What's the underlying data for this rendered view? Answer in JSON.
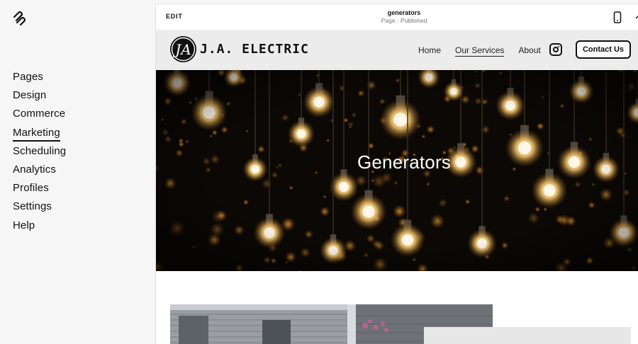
{
  "sidebar": {
    "logo_icon": "squarespace-logo-icon",
    "items": [
      {
        "label": "Pages",
        "active": false
      },
      {
        "label": "Design",
        "active": false
      },
      {
        "label": "Commerce",
        "active": false
      },
      {
        "label": "Marketing",
        "active": true
      },
      {
        "label": "Scheduling",
        "active": false
      },
      {
        "label": "Analytics",
        "active": false
      },
      {
        "label": "Profiles",
        "active": false
      },
      {
        "label": "Settings",
        "active": false
      },
      {
        "label": "Help",
        "active": false
      }
    ]
  },
  "editor_bar": {
    "edit_label": "EDIT",
    "page_name": "generators",
    "page_status": "Page · Published",
    "device_icon": "mobile-phone-icon",
    "expand_icon": "chevron-up-icon"
  },
  "site": {
    "name": "J.A. ELECTRIC",
    "logo_icon": "ja-monogram-icon",
    "nav": [
      {
        "label": "Home",
        "current": false
      },
      {
        "label": "Our Services",
        "current": true
      },
      {
        "label": "About",
        "current": false
      }
    ],
    "social_icon": "instagram-icon",
    "cta_label": "Contact Us"
  },
  "hero": {
    "title": "Generators"
  },
  "colors": {
    "sidebar_bg": "#f6f6f6",
    "header_bg": "#ececec",
    "hero_bg": "#0b0805",
    "bulb_glow": "#f5c46a"
  }
}
